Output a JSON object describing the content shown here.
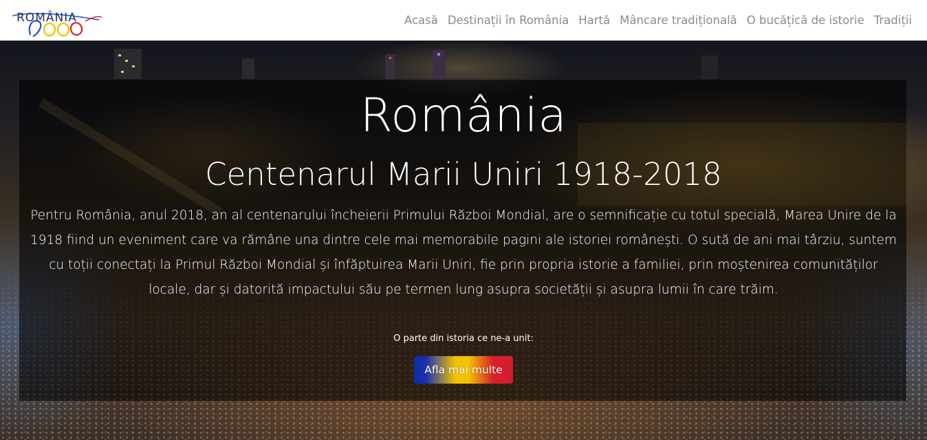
{
  "navbar": {
    "brand": {
      "text": "ROMÂNIA",
      "colors": [
        "#1f4fbf",
        "#f2c400",
        "#d8202a"
      ]
    },
    "links": [
      "Acasă",
      "Destinații în România",
      "Hartă",
      "Mâncare tradițională",
      "O bucățică de istorie",
      "Tradiții"
    ]
  },
  "hero": {
    "title": "România",
    "subtitle": "Centenarul Marii Uniri 1918-2018",
    "paragraph": "Pentru România, anul 2018, an al centenarului încheierii Primului Război Mondial, are o semnificație cu totul specială, Marea Unire de la 1918 fiind un eveniment care va rămâne una dintre cele mai memorabile pagini ale istoriei românești. O sută de ani mai târziu, suntem cu toții conectați la Primul Război Mondial și înfăptuirea Marii Uniri, fie prin propria istorie a familiei, prin moștenirea comunităților locale, dar și datorită impactului său pe termen lung asupra societății și asupra lumii în care trăim.",
    "cta_caption": "O parte din istoria ce ne-a unit:",
    "cta_button": "Afla mai multe",
    "cta_colors": [
      "#0b2fa4",
      "#f2c400",
      "#d41c2e"
    ]
  }
}
